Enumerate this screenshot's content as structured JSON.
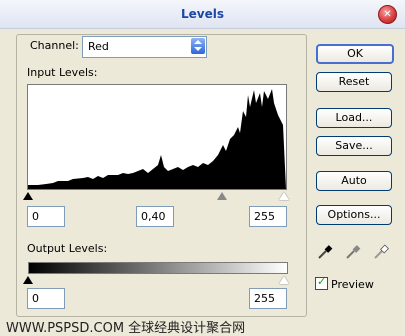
{
  "window": {
    "title": "Levels",
    "close_icon": "close-icon"
  },
  "channel": {
    "label": "Channel:",
    "value": "Red"
  },
  "input_levels": {
    "label": "Input Levels:",
    "black": "0",
    "gamma": "0,40",
    "white": "255"
  },
  "output_levels": {
    "label": "Output Levels:",
    "black": "0",
    "white": "255"
  },
  "buttons": {
    "ok": "OK",
    "reset": "Reset",
    "load": "Load...",
    "save": "Save...",
    "auto": "Auto",
    "options": "Options..."
  },
  "preview": {
    "label": "Preview",
    "checked": true
  },
  "watermark": "WWW.PSPSD.COM 全球经典设计聚合网"
}
